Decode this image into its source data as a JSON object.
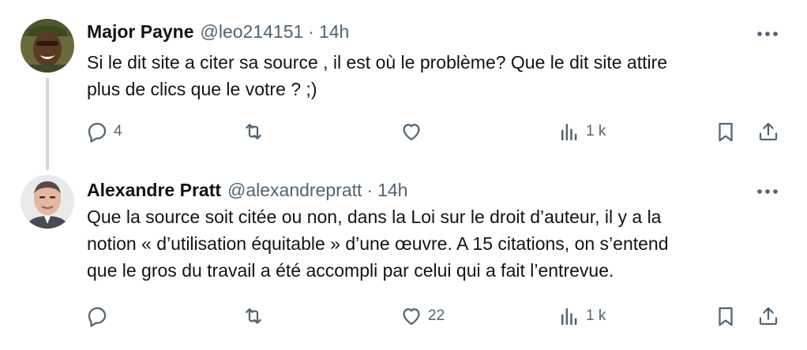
{
  "tweets": [
    {
      "display_name": "Major Payne",
      "handle": "@leo214151",
      "separator": "·",
      "time": "14h",
      "lines": [
        "Si le dit site a citer sa source , il est où le problème? Que le dit site attire",
        "plus de clics que le votre ? ;)"
      ],
      "replies": "4",
      "retweets": "",
      "likes": "",
      "views": "1 k"
    },
    {
      "display_name": "Alexandre Pratt",
      "handle": "@alexandrepratt",
      "separator": "·",
      "time": "14h",
      "lines": [
        "Que la source soit citée ou non, dans la Loi sur le droit d’auteur, il y a la",
        "notion « d’utilisation équitable » d’une œuvre. A 15 citations, on s’entend",
        "que le gros du travail a été accompli par celui qui a fait l’entrevue."
      ],
      "replies": "",
      "retweets": "",
      "likes": "22",
      "views": "1 k"
    }
  ],
  "colors": {
    "text": "#0f1419",
    "secondary": "#536471",
    "thread_line": "#cfd9de"
  }
}
